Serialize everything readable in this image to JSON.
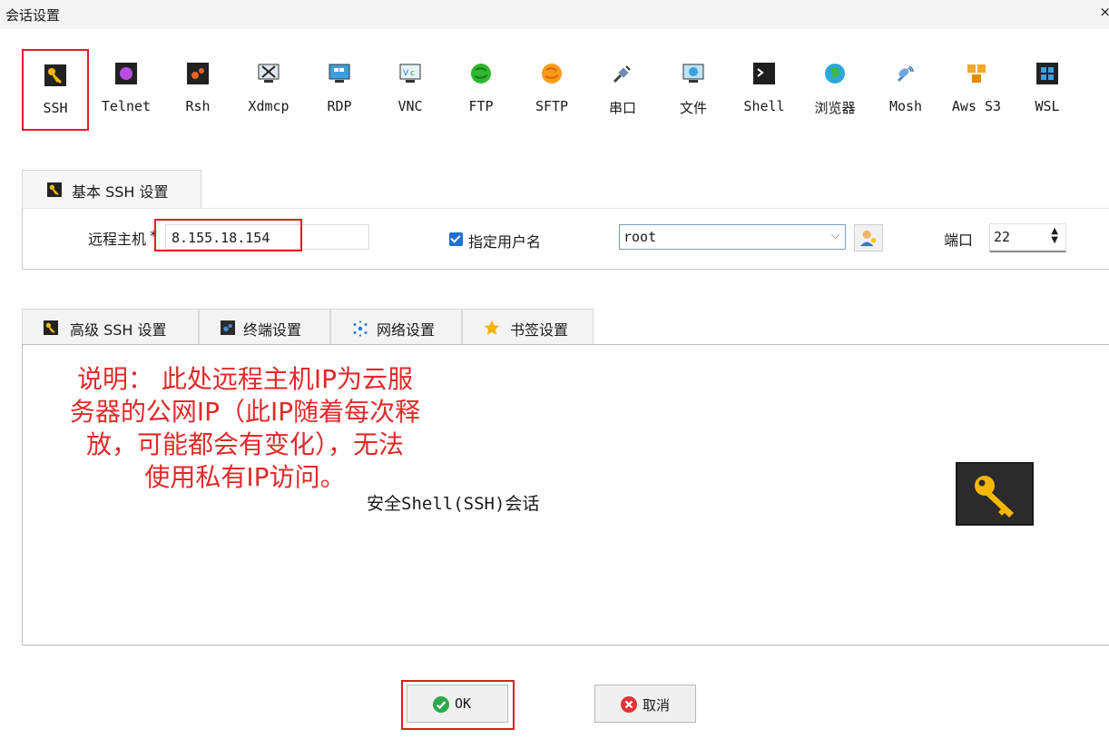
{
  "window": {
    "title": "会话设置",
    "close_label": "×"
  },
  "session_types": [
    {
      "label": "SSH",
      "icon": "key-icon",
      "selected": true
    },
    {
      "label": "Telnet",
      "icon": "telnet-icon"
    },
    {
      "label": "Rsh",
      "icon": "rsh-icon"
    },
    {
      "label": "Xdmcp",
      "icon": "xdmcp-icon"
    },
    {
      "label": "RDP",
      "icon": "rdp-icon"
    },
    {
      "label": "VNC",
      "icon": "vnc-icon"
    },
    {
      "label": "FTP",
      "icon": "ftp-icon"
    },
    {
      "label": "SFTP",
      "icon": "sftp-icon"
    },
    {
      "label": "串口",
      "icon": "serial-icon"
    },
    {
      "label": "文件",
      "icon": "file-icon"
    },
    {
      "label": "Shell",
      "icon": "shell-icon"
    },
    {
      "label": "浏览器",
      "icon": "browser-icon"
    },
    {
      "label": "Mosh",
      "icon": "mosh-icon"
    },
    {
      "label": "Aws S3",
      "icon": "aws-s3-icon"
    },
    {
      "label": "WSL",
      "icon": "wsl-icon"
    }
  ],
  "basic": {
    "tab_label": "基本 SSH 设置",
    "remote_host_label": "远程主机",
    "required_marker": "*",
    "remote_host_value": "8.155.18.154",
    "specify_username_label": "指定用户名",
    "specify_username_checked": true,
    "username_value": "root",
    "port_label": "端口",
    "port_value": "22"
  },
  "advanced_tabs": [
    {
      "label": "高级 SSH 设置",
      "icon": "key-icon"
    },
    {
      "label": "终端设置",
      "icon": "terminal-icon"
    },
    {
      "label": "网络设置",
      "icon": "network-icon"
    },
    {
      "label": "书签设置",
      "icon": "star-icon"
    }
  ],
  "panel": {
    "note_lines": [
      "说明： 此处远程主机IP为云服",
      "务器的公网IP（此IP随着每次释",
      "放，可能都会有变化），无法",
      "使用私有IP访问。"
    ],
    "session_description": "安全Shell(SSH)会话"
  },
  "buttons": {
    "ok_label": "OK",
    "cancel_label": "取消"
  },
  "colors": {
    "highlight": "#e01e1e",
    "note_text": "#e02a2a",
    "accent_blue": "#1f6fd1"
  }
}
